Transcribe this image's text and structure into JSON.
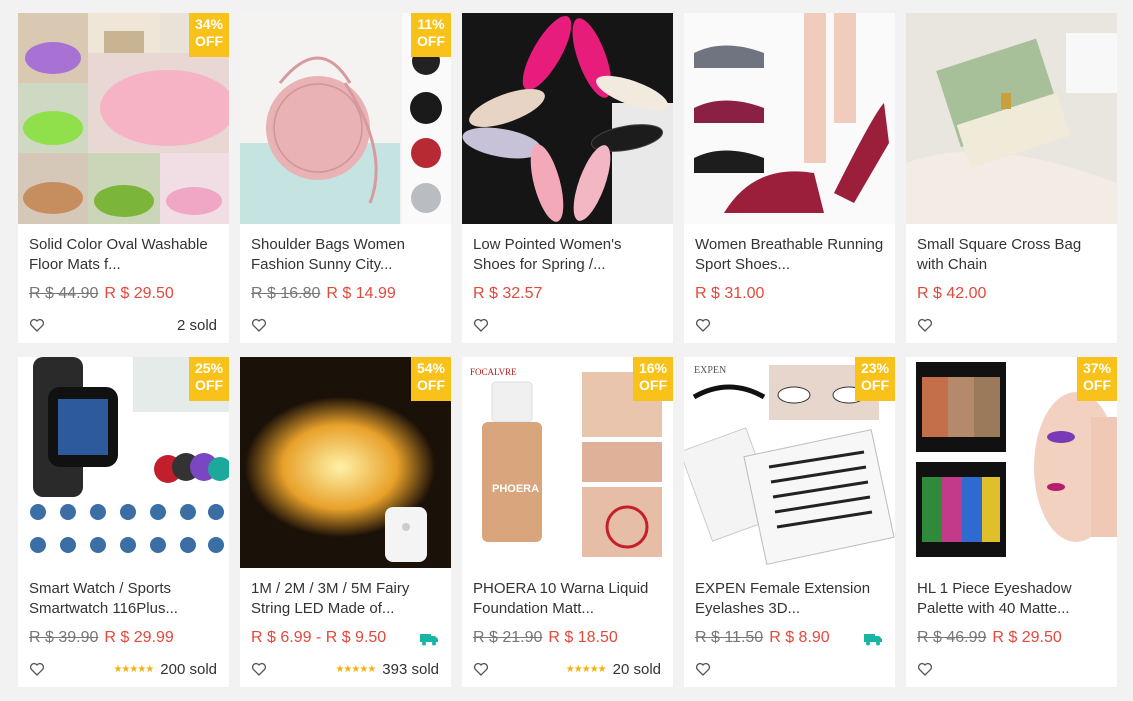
{
  "products": [
    {
      "title": "Solid Color Oval Washable Floor Mats f...",
      "old_price": "R $ 44.90",
      "price": "R $ 29.50",
      "discount": "34%",
      "off": "OFF",
      "sold": "2 sold",
      "stars": "",
      "image": "oval-floor-mats"
    },
    {
      "title": "Shoulder Bags Women Fashion Sunny City...",
      "old_price": "R $ 16.80",
      "price": "R $ 14.99",
      "discount": "11%",
      "off": "OFF",
      "sold": "",
      "stars": "",
      "image": "round-pink-bag"
    },
    {
      "title": "Low Pointed Women's Shoes for Spring /...",
      "old_price": "",
      "price": "R $ 32.57",
      "discount": "",
      "off": "",
      "sold": "",
      "stars": "",
      "image": "pointed-flat-shoes"
    },
    {
      "title": "Women Breathable Running Sport Shoes...",
      "old_price": "",
      "price": "R $ 31.00",
      "discount": "",
      "off": "",
      "sold": "",
      "stars": "",
      "image": "sport-shoes"
    },
    {
      "title": "Small Square Cross Bag with Chain",
      "old_price": "",
      "price": "R $ 42.00",
      "discount": "",
      "off": "",
      "sold": "",
      "stars": "",
      "image": "green-cross-bag"
    },
    {
      "title": "Smart Watch / Sports Smartwatch 116Plus...",
      "old_price": "R $ 39.90",
      "price": "R $ 29.99",
      "discount": "25%",
      "off": "OFF",
      "sold": "",
      "stars": "",
      "image": "smartwatch"
    },
    {
      "title": "1M / 2M / 3M / 5M Fairy String LED Made of...",
      "old_price": "",
      "price": "R $ 6.99 - R $ 9.50",
      "discount": "54%",
      "off": "OFF",
      "sold": "393 sold",
      "stars": "★★★★★",
      "image": "fairy-lights",
      "free_shipping": true
    },
    {
      "title": "PHOERA 10 Warna Liquid Foundation Matt...",
      "old_price": "R $ 21.90",
      "price": "R $ 18.50",
      "discount": "16%",
      "off": "OFF",
      "sold": "20 sold",
      "stars": "★★★★★",
      "image": "foundation",
      "brand": "FOCALVRE",
      "bottle_label": "PHOERA"
    },
    {
      "title": "EXPEN Female Extension Eyelashes 3D...",
      "old_price": "R $ 11.50",
      "price": "R $ 8.90",
      "discount": "23%",
      "off": "OFF",
      "sold": "",
      "stars": "",
      "image": "eyelashes",
      "free_shipping": true,
      "brand": "EXPEN"
    },
    {
      "title": "HL 1 Piece Eyeshadow Palette with 40 Matte...",
      "old_price": "R $ 46.99",
      "price": "R $ 29.50",
      "discount": "37%",
      "off": "OFF",
      "sold": "",
      "stars": "",
      "image": "eyeshadow-palette"
    }
  ],
  "extra": {
    "watch_sold": "200 sold",
    "watch_stars": "★★★★★"
  },
  "colors": {
    "price": "#e3493b",
    "badge": "#f8c21a",
    "stars": "#f3b20f",
    "shipping": "#18b5a5"
  }
}
